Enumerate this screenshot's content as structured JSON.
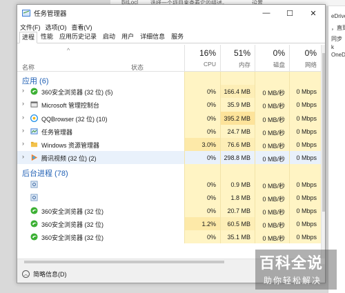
{
  "background": {
    "top_text_1": "BitLocl",
    "top_text_2": "选择一个项目来查看它的描述。",
    "top_text_3": "设置",
    "right_texts": [
      "eDrive",
      "，直到",
      "同步",
      "k",
      "OneD"
    ]
  },
  "window": {
    "title": "任务管理器",
    "minimize_glyph": "—",
    "maximize_glyph": "☐",
    "close_glyph": "✕"
  },
  "menu": [
    "文件(F)",
    "选项(O)",
    "查看(V)"
  ],
  "tabs": [
    "进程",
    "性能",
    "应用历史记录",
    "启动",
    "用户",
    "详细信息",
    "服务"
  ],
  "active_tab": "进程",
  "header": {
    "name_label": "名称",
    "status_label": "状态",
    "cpu_pct": "16%",
    "cpu_label": "CPU",
    "mem_pct": "51%",
    "mem_label": "内存",
    "disk_pct": "0%",
    "disk_label": "磁盘",
    "net_pct": "0%",
    "net_label": "网络"
  },
  "apps_group": "应用 (6)",
  "apps": [
    {
      "name": "360安全浏览器 (32 位) (5)",
      "icon": "360-browser-icon",
      "cpu": "0%",
      "mem": "166.4 MB",
      "disk": "0 MB/秒",
      "net": "0 Mbps"
    },
    {
      "name": "Microsoft 管理控制台",
      "icon": "mmc-icon",
      "cpu": "0%",
      "mem": "35.9 MB",
      "disk": "0 MB/秒",
      "net": "0 Mbps"
    },
    {
      "name": "QQBrowser (32 位) (10)",
      "icon": "qqbrowser-icon",
      "cpu": "0%",
      "mem": "395.2 MB",
      "disk": "0 MB/秒",
      "net": "0 Mbps"
    },
    {
      "name": "任务管理器",
      "icon": "task-manager-icon",
      "cpu": "0%",
      "mem": "24.7 MB",
      "disk": "0 MB/秒",
      "net": "0 Mbps"
    },
    {
      "name": "Windows 资源管理器",
      "icon": "explorer-icon",
      "cpu": "3.0%",
      "mem": "76.6 MB",
      "disk": "0 MB/秒",
      "net": "0 Mbps"
    },
    {
      "name": "腾讯视频 (32 位) (2)",
      "icon": "tencent-video-icon",
      "cpu": "0%",
      "mem": "298.8 MB",
      "disk": "0 MB/秒",
      "net": "0 Mbps"
    }
  ],
  "bg_group": "后台进程 (78)",
  "bg": [
    {
      "name": "",
      "icon": "gear-process-icon",
      "cpu": "0%",
      "mem": "0.9 MB",
      "disk": "0 MB/秒",
      "net": "0 Mbps"
    },
    {
      "name": "",
      "icon": "gear-process-icon",
      "cpu": "0%",
      "mem": "1.8 MB",
      "disk": "0 MB/秒",
      "net": "0 Mbps"
    },
    {
      "name": "360安全浏览器 (32 位)",
      "icon": "360-browser-icon",
      "cpu": "0%",
      "mem": "20.7 MB",
      "disk": "0 MB/秒",
      "net": "0 Mbps"
    },
    {
      "name": "360安全浏览器 (32 位)",
      "icon": "360-browser-icon",
      "cpu": "1.2%",
      "mem": "60.5 MB",
      "disk": "0 MB/秒",
      "net": "0 Mbps"
    },
    {
      "name": "360安全浏览器 (32 位)",
      "icon": "360-browser-icon",
      "cpu": "0%",
      "mem": "35.1 MB",
      "disk": "0 MB/秒",
      "net": "0 Mbps"
    }
  ],
  "footer": {
    "label": "简略信息(D)"
  },
  "watermark": {
    "big": "百科全说",
    "small": "助你轻松解决"
  },
  "colors": {
    "heat_light": "#fff4c4",
    "heat_mid": "#fde9a8",
    "group_title": "#1f5fb4",
    "selected_row": "#e9f1fb"
  }
}
